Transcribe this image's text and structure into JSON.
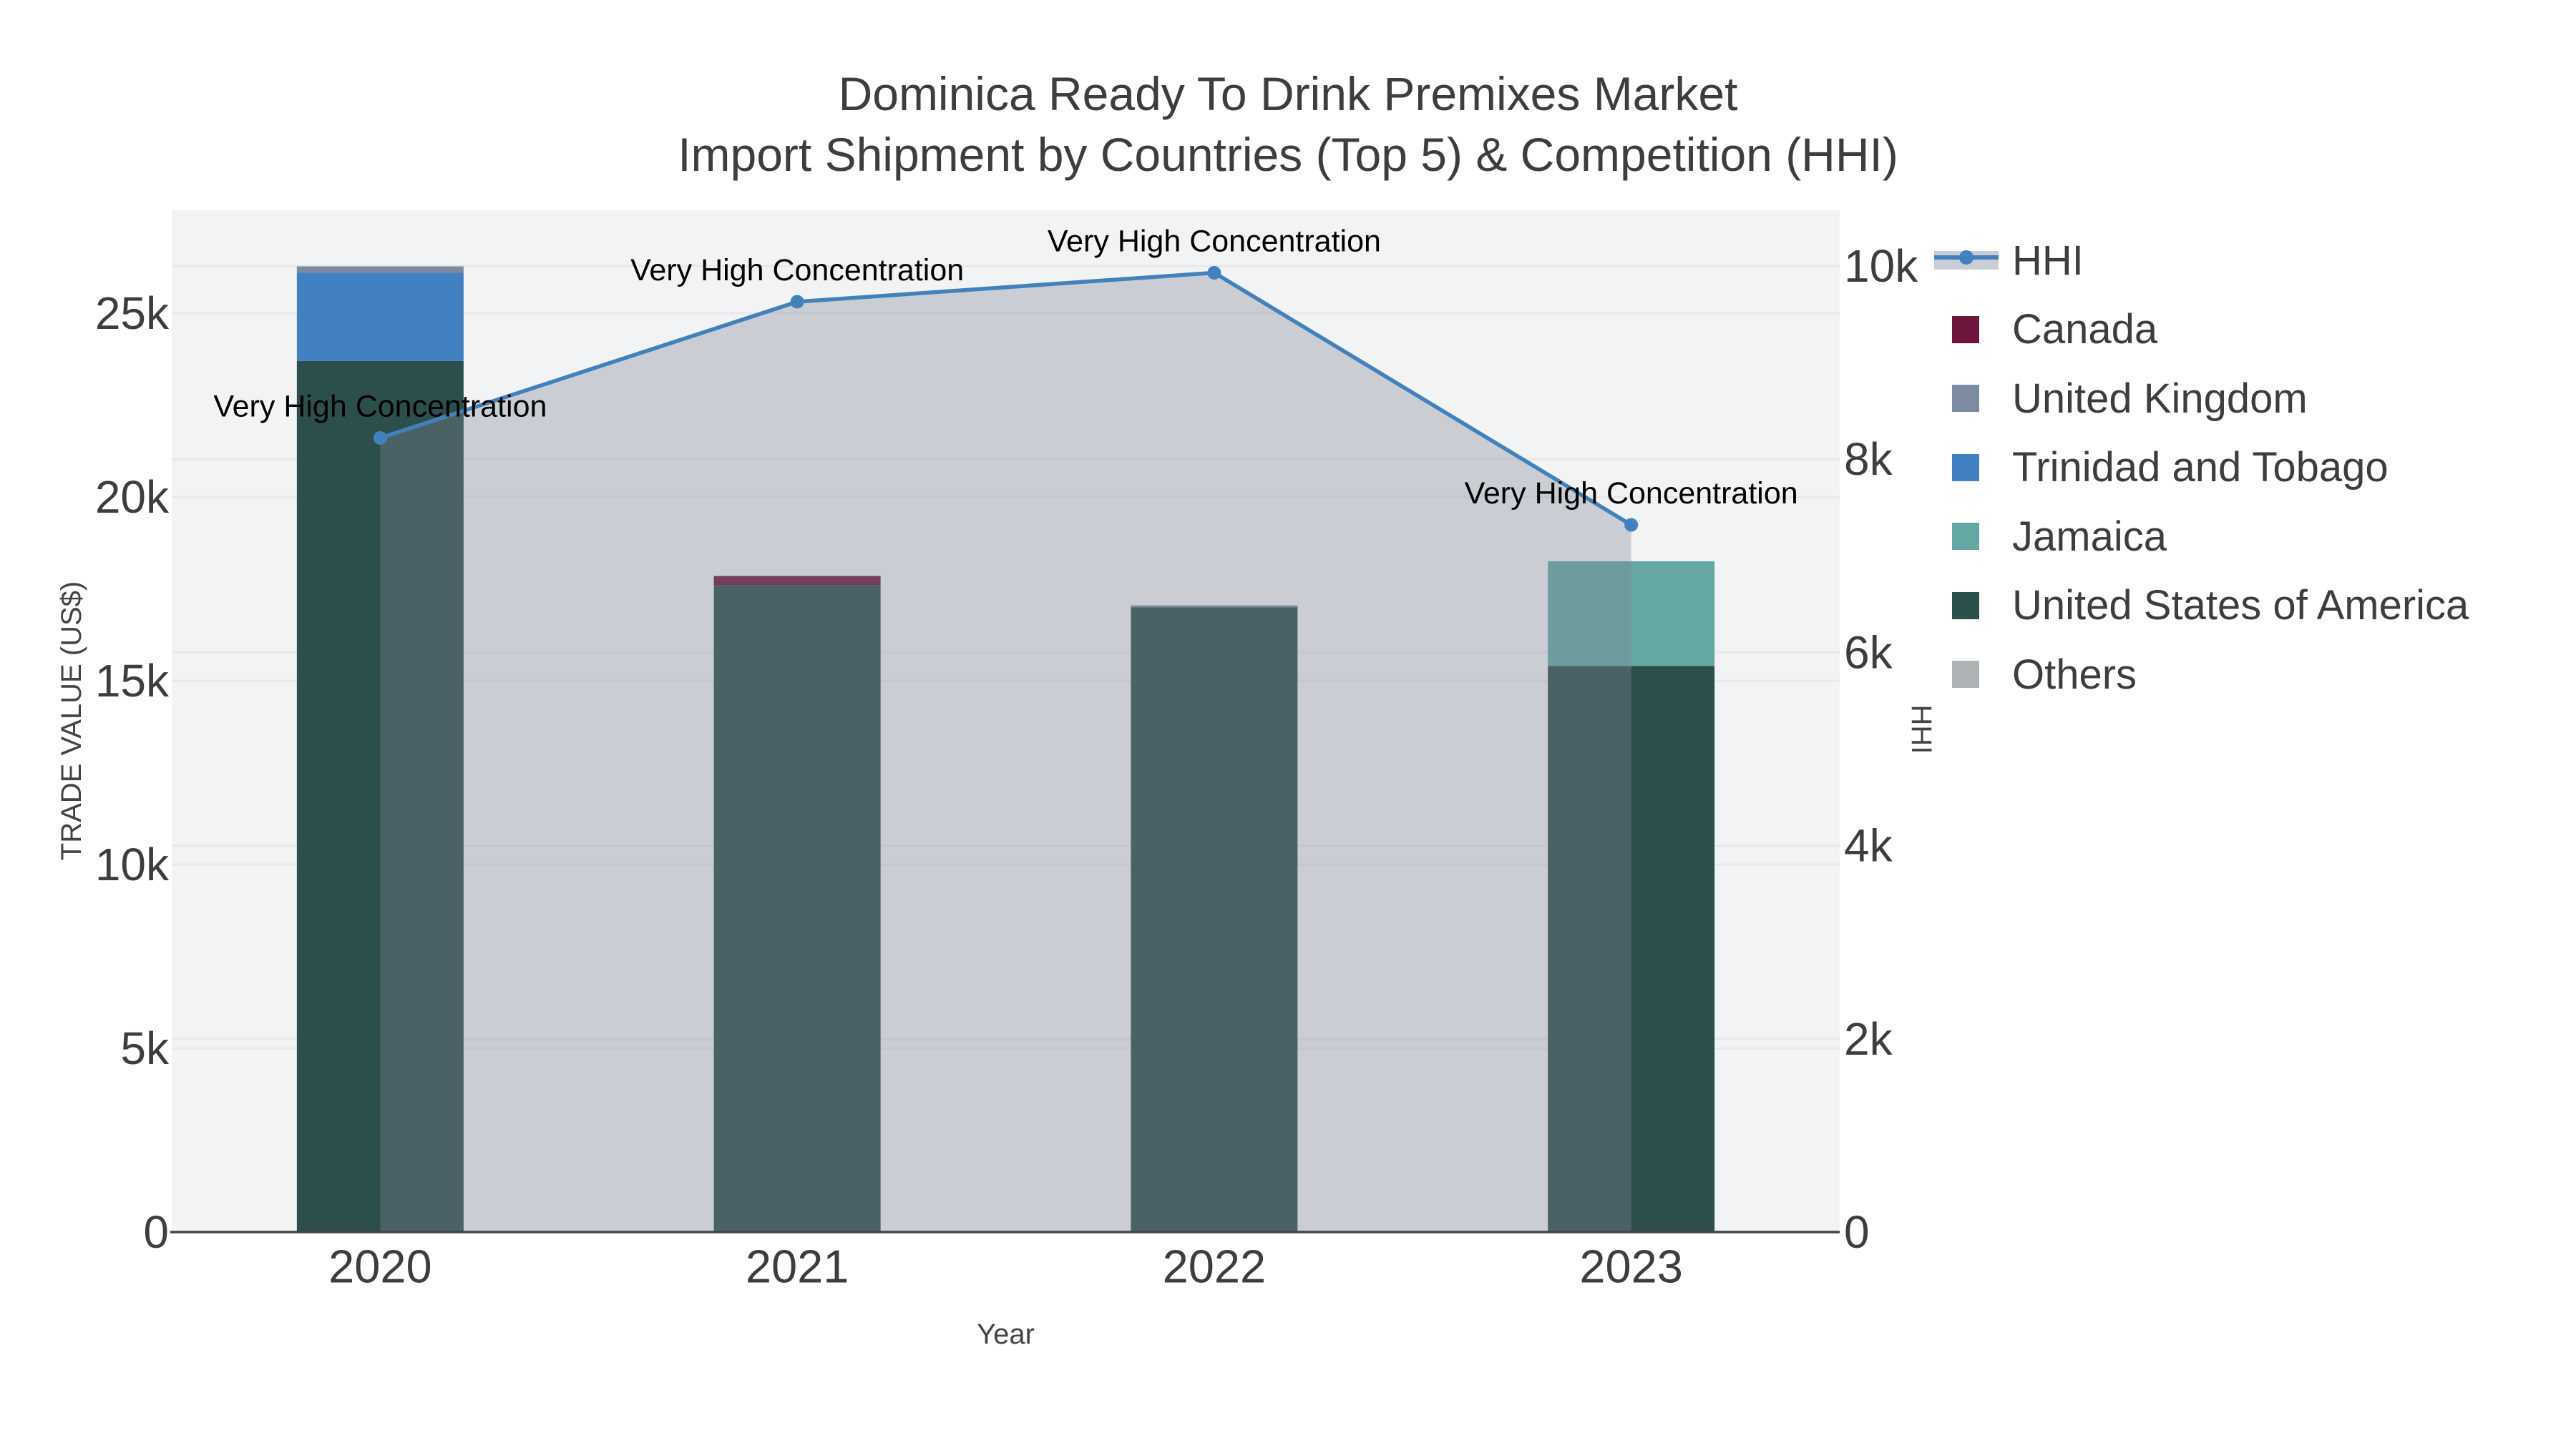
{
  "title": {
    "line1": "Dominica Ready To Drink Premixes Market",
    "line2": "Import Shipment by Countries (Top 5) & Competition (HHI)"
  },
  "colors": {
    "hhi_line": "#4181bc",
    "area_fill": "rgba(128,134,150,0.35)",
    "plot_bg": "#f2f3f4",
    "grid": "#e7e8ea",
    "axis_line": "#444444",
    "text": "#3d3d3d",
    "annotation": "#000000",
    "legend_hhi_band": "#c9cdd6"
  },
  "chart_data": {
    "type": "bar+line",
    "categories": [
      "2020",
      "2021",
      "2022",
      "2023"
    ],
    "bar_unit": "US$",
    "series": [
      {
        "name": "United States of America",
        "color": "#2d4f4c",
        "values": [
          23700,
          17600,
          17000,
          15400
        ]
      },
      {
        "name": "Jamaica",
        "color": "#65a8a3",
        "values": [
          0,
          0,
          0,
          2850
        ]
      },
      {
        "name": "Trinidad and Tobago",
        "color": "#4181c1",
        "values": [
          2400,
          0,
          0,
          0
        ]
      },
      {
        "name": "United Kingdom",
        "color": "#7d8ba1",
        "values": [
          175,
          0,
          50,
          0
        ]
      },
      {
        "name": "Canada",
        "color": "#6e163d",
        "values": [
          0,
          250,
          0,
          0
        ]
      },
      {
        "name": "Others",
        "color": "#aeb2b5",
        "values": [
          0,
          0,
          0,
          0
        ]
      }
    ],
    "line_series": {
      "name": "HHI",
      "color": "#4181bc",
      "values": [
        8220,
        9630,
        9930,
        7320
      ]
    },
    "annotations": [
      {
        "category": "2020",
        "text": "Very High Concentration"
      },
      {
        "category": "2021",
        "text": "Very High Concentration"
      },
      {
        "category": "2022",
        "text": "Very High Concentration"
      },
      {
        "category": "2023",
        "text": "Very High Concentration"
      }
    ],
    "axes": {
      "x": {
        "title": "Year",
        "tick_labels": [
          "2020",
          "2021",
          "2022",
          "2023"
        ]
      },
      "y_left": {
        "title": "TRADE VALUE (US$)",
        "max": 25000,
        "ticks": [
          {
            "label": "0",
            "value": 0
          },
          {
            "label": "5k",
            "value": 5000
          },
          {
            "label": "10k",
            "value": 10000
          },
          {
            "label": "15k",
            "value": 15000
          },
          {
            "label": "20k",
            "value": 20000
          },
          {
            "label": "25k",
            "value": 25000
          }
        ]
      },
      "y_right": {
        "title": "HHI",
        "max": 10000,
        "ticks": [
          {
            "label": "0",
            "value": 0
          },
          {
            "label": "2k",
            "value": 2000
          },
          {
            "label": "4k",
            "value": 4000
          },
          {
            "label": "6k",
            "value": 6000
          },
          {
            "label": "8k",
            "value": 8000
          },
          {
            "label": "10k",
            "value": 10000
          }
        ]
      }
    },
    "legend": [
      {
        "label": "HHI",
        "type": "line",
        "color": "#4181bc"
      },
      {
        "label": "Canada",
        "type": "swatch",
        "color": "#6e163d"
      },
      {
        "label": "United Kingdom",
        "type": "swatch",
        "color": "#7d8ba1"
      },
      {
        "label": "Trinidad and Tobago",
        "type": "swatch",
        "color": "#4181c1"
      },
      {
        "label": "Jamaica",
        "type": "swatch",
        "color": "#65a8a3"
      },
      {
        "label": "United States of America",
        "type": "swatch",
        "color": "#2d4f4c"
      },
      {
        "label": "Others",
        "type": "swatch",
        "color": "#aeb2b5"
      }
    ]
  }
}
